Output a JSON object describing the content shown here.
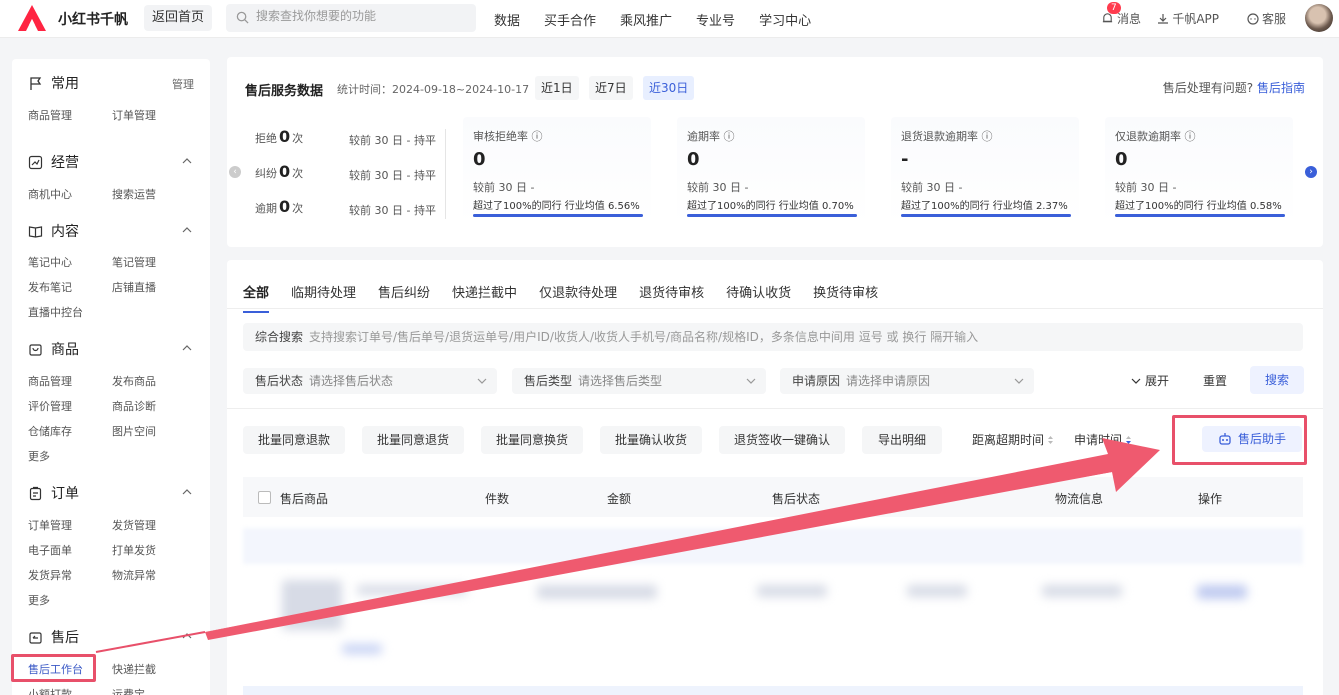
{
  "brand": {
    "name": "小红书千帆"
  },
  "header": {
    "back_home": "返回首页",
    "search_placeholder": "搜索查找你想要的功能",
    "nav": [
      "数据",
      "买手合作",
      "乘风推广",
      "专业号",
      "学习中心"
    ],
    "messages_label": "消息",
    "messages_count": "7",
    "app_label": "千帆APP",
    "service_label": "客服"
  },
  "sidebar": {
    "sections": [
      {
        "title": "常用",
        "tail": "管理",
        "links": [
          "商品管理",
          "订单管理"
        ]
      },
      {
        "title": "经营",
        "links": [
          "商机中心",
          "搜索运营"
        ]
      },
      {
        "title": "内容",
        "links": [
          "笔记中心",
          "笔记管理",
          "发布笔记",
          "店铺直播",
          "直播中控台"
        ]
      },
      {
        "title": "商品",
        "links": [
          "商品管理",
          "发布商品",
          "评价管理",
          "商品诊断",
          "仓储库存",
          "图片空间",
          "更多"
        ]
      },
      {
        "title": "订单",
        "links": [
          "订单管理",
          "发货管理",
          "电子面单",
          "打单发货",
          "发货异常",
          "物流异常",
          "更多"
        ]
      },
      {
        "title": "售后",
        "links": [
          "售后工作台",
          "快递拦截",
          "小额打款",
          "运费宝"
        ]
      }
    ]
  },
  "service_card": {
    "title": "售后服务数据",
    "stat_time": "统计时间：2024-09-18~2024-10-17",
    "ranges": [
      "近1日",
      "近7日",
      "近30日"
    ],
    "help_text": "售后处理有问题?",
    "help_link": "售后指南",
    "mini_kpis": [
      {
        "label": "拒绝",
        "value": "0",
        "unit": "次",
        "compare": "较前 30 日",
        "trend": "- 持平"
      },
      {
        "label": "纠纷",
        "value": "0",
        "unit": "次",
        "compare": "较前 30 日",
        "trend": "- 持平"
      },
      {
        "label": "逾期",
        "value": "0",
        "unit": "次",
        "compare": "较前 30 日",
        "trend": "- 持平"
      }
    ],
    "metrics": [
      {
        "label": "审核拒绝率 ⓘ",
        "value": "0",
        "compare": "较前 30 日 -",
        "peer": "超过了100%的同行 行业均值 6.56%",
        "pct": 1.0
      },
      {
        "label": "逾期率 ⓘ",
        "value": "0",
        "compare": "较前 30 日 -",
        "peer": "超过了100%的同行 行业均值 0.70%",
        "pct": 1.0
      },
      {
        "label": "退货退款逾期率 ⓘ",
        "value": "-",
        "compare": "较前 30 日 -",
        "peer": "超过了100%的同行 行业均值 2.37%",
        "pct": 1.0
      },
      {
        "label": "仅退款逾期率 ⓘ",
        "value": "0",
        "compare": "较前 30 日 -",
        "peer": "超过了100%的同行 行业均值 0.58%",
        "pct": 1.0
      }
    ]
  },
  "orders_card": {
    "tabs": [
      "全部",
      "临期待处理",
      "售后纠纷",
      "快递拦截中",
      "仅退款待处理",
      "退货待审核",
      "待确认收货",
      "换货待审核"
    ],
    "combo_search_label": "综合搜索",
    "combo_search_placeholder": "支持搜索订单号/售后单号/退货运单号/用户ID/收货人/收货人手机号/商品名称/规格ID，多条信息中间用 逗号 或 换行 隔开输入",
    "filters": [
      {
        "label": "售后状态",
        "placeholder": "请选择售后状态"
      },
      {
        "label": "售后类型",
        "placeholder": "请选择售后类型"
      },
      {
        "label": "申请原因",
        "placeholder": "请选择申请原因"
      }
    ],
    "expand": "展开",
    "reset": "重置",
    "search": "搜索",
    "batch_buttons": [
      "批量同意退款",
      "批量同意退货",
      "批量同意换货",
      "批量确认收货",
      "退货签收一键确认",
      "导出明细"
    ],
    "sorts": [
      "距离超期时间",
      "申请时间"
    ],
    "assistant": "售后助手",
    "table_headers": [
      "售后商品",
      "件数",
      "金额",
      "售后状态",
      "物流信息",
      "操作"
    ]
  },
  "colors": {
    "accent": "#3a5fd9",
    "brand_red": "#ff2442",
    "annotation": "#e8506a"
  }
}
